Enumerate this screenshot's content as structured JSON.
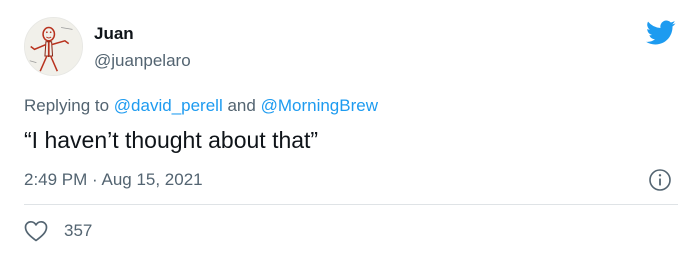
{
  "author": {
    "display_name": "Juan",
    "handle": "@juanpelaro"
  },
  "reply": {
    "prefix": "Replying to",
    "mention_1": "@david_perell",
    "connector": "and",
    "mention_2": "@MorningBrew"
  },
  "tweet": {
    "text": "“I haven’t thought about that”",
    "timestamp": "2:49 PM · Aug 15, 2021"
  },
  "engagement": {
    "likes": "357"
  },
  "icons": {
    "brand": "twitter-bird-icon",
    "info": "info-icon",
    "like": "heart-icon",
    "avatar": "child-drawing-avatar"
  },
  "colors": {
    "link": "#1d9bf0",
    "secondary_text": "#536471",
    "primary_text": "#0f1419",
    "brand": "#1d9bf0"
  }
}
